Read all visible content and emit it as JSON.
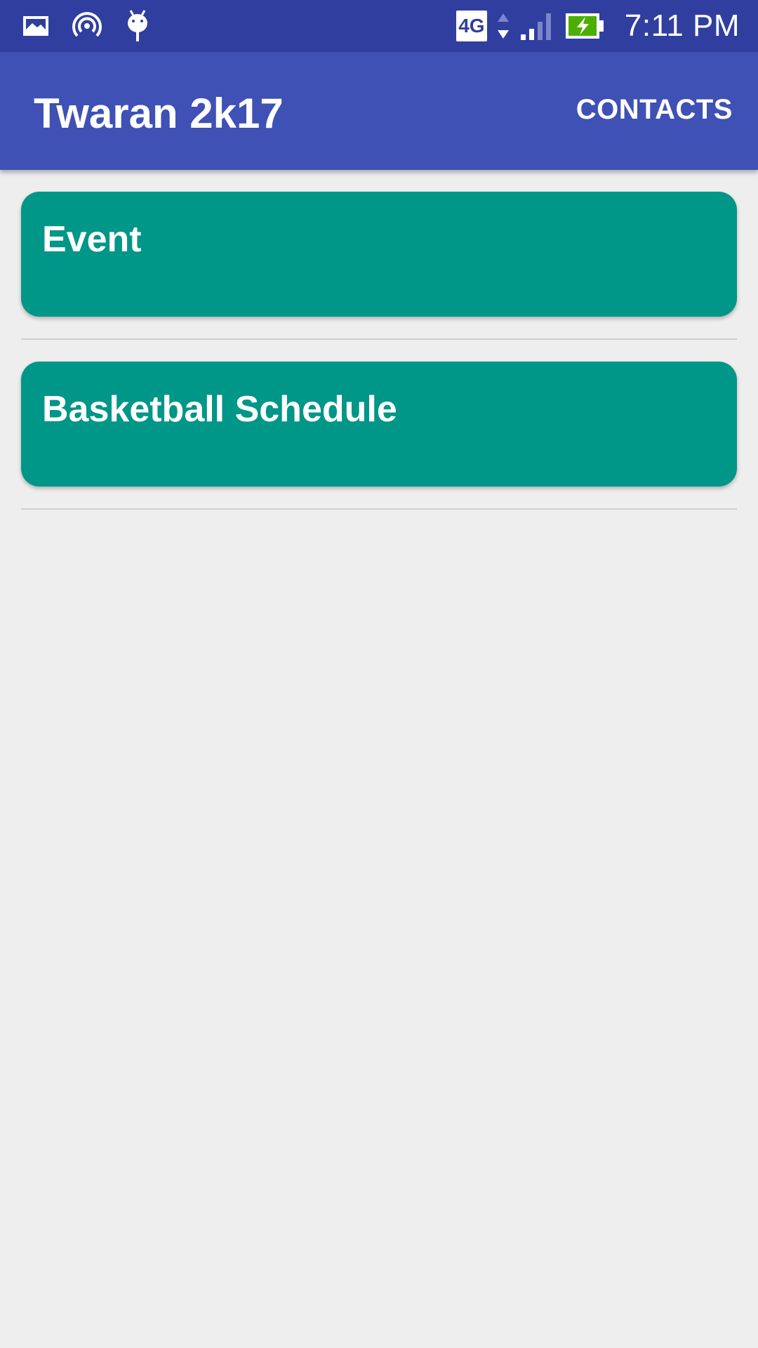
{
  "status_bar": {
    "network_label": "4G",
    "time": "7:11 PM",
    "left_icons": [
      "image-icon",
      "hotspot-icon",
      "android-debug-icon"
    ],
    "right_icons": [
      "data-arrows-icon",
      "signal-icon",
      "battery-charging-icon"
    ],
    "background_color": "#303f9f"
  },
  "app_bar": {
    "title": "Twaran 2k17",
    "action_label": "CONTACTS",
    "background_color": "#3f51b5"
  },
  "list": {
    "items": [
      {
        "title": "Event"
      },
      {
        "title": "Basketball Schedule"
      }
    ],
    "card_color": "#009688"
  }
}
